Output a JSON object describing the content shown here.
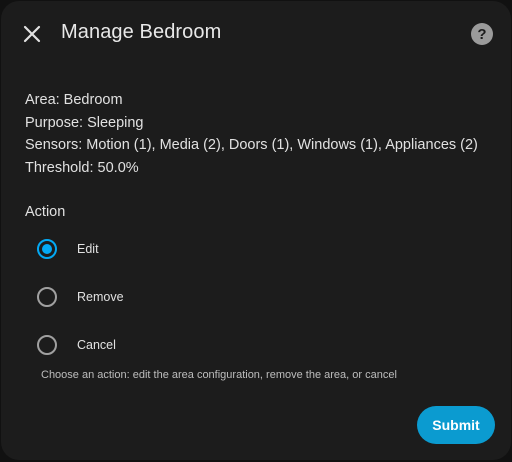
{
  "dialog": {
    "title": "Manage Bedroom",
    "close_icon": "close-icon",
    "help_icon": "help-circle-icon",
    "help_glyph": "?"
  },
  "info": {
    "area": "Area: Bedroom",
    "purpose": "Purpose: Sleeping",
    "sensors": "Sensors: Motion (1), Media (2), Doors (1), Windows (1), Appliances (2)",
    "threshold": "Threshold: 50.0%"
  },
  "action": {
    "label": "Action",
    "options": [
      {
        "label": "Edit",
        "selected": true
      },
      {
        "label": "Remove",
        "selected": false
      },
      {
        "label": "Cancel",
        "selected": false
      }
    ],
    "helper": "Choose an action: edit the area configuration, remove the area, or cancel"
  },
  "footer": {
    "submit_label": "Submit"
  },
  "colors": {
    "accent": "#03a9f4",
    "submit": "#0b9bd0",
    "surface": "#1c1c1c",
    "background": "#111111"
  }
}
